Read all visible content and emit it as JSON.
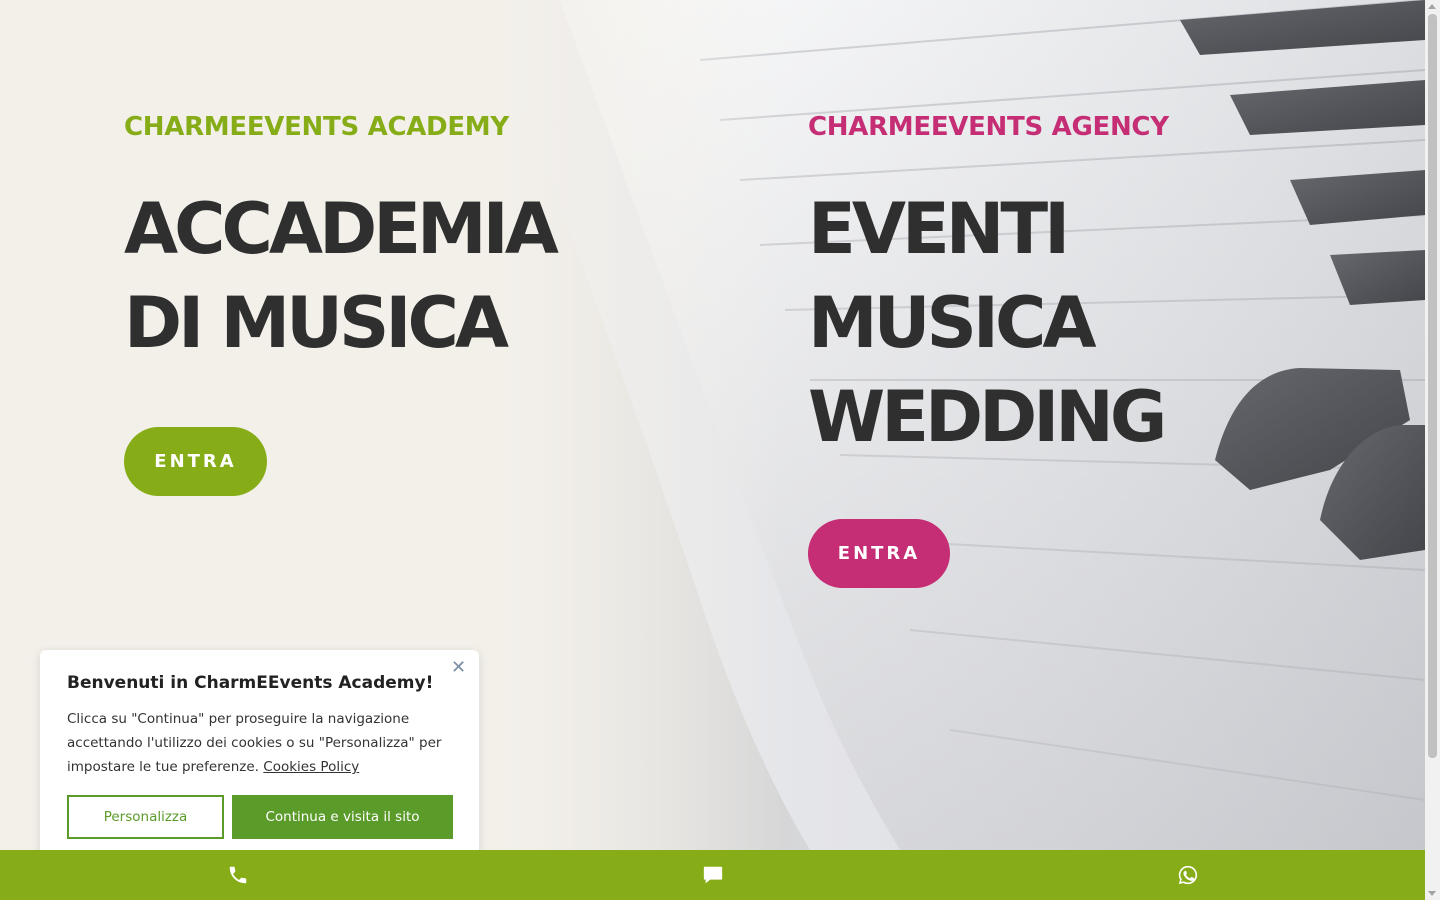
{
  "academy": {
    "eyebrow": "CHARMEEVENTS ACADEMY",
    "headline_lines": [
      "ACCADEMIA",
      "DI MUSICA"
    ],
    "button_label": "ENTRA",
    "accent_color": "#86ad17"
  },
  "agency": {
    "eyebrow": "CHARMEEVENTS AGENCY",
    "headline_lines": [
      "EVENTI",
      "MUSICA",
      "WEDDING"
    ],
    "button_label": "ENTRA",
    "accent_color": "#c52d74"
  },
  "cookie_banner": {
    "title": "Benvenuti in CharmEEvents Academy!",
    "text": "Clicca su \"Continua\" per proseguire la navigazione accettando l'utilizzo dei cookies o su \"Personalizza\" per impostare le tue preferenze.",
    "link_label": "Cookies Policy",
    "customize_label": "Personalizza",
    "continue_label": "Continua e visita il sito",
    "close_icon": "close-icon",
    "button_color": "#5a9b2a"
  },
  "bottom_bar": {
    "items": [
      {
        "icon": "phone-icon"
      },
      {
        "icon": "chat-icon"
      },
      {
        "icon": "whatsapp-icon"
      }
    ],
    "color": "#86ad17"
  },
  "background": {
    "image": "piano-keys-icon"
  }
}
